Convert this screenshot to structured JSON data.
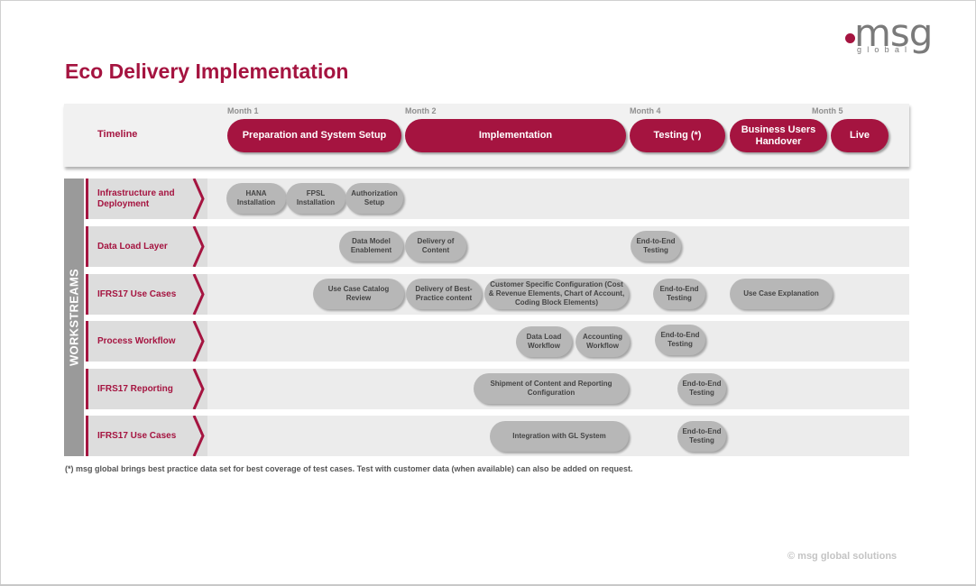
{
  "logo": {
    "word": "msg",
    "sub": "global"
  },
  "title": "Eco Delivery Implementation",
  "timeline": {
    "label": "Timeline",
    "months": [
      "Month 1",
      "Month 2",
      "Month 4",
      "Month 5"
    ],
    "phases": [
      "Preparation and System Setup",
      "Implementation",
      "Testing (*)",
      "Business Users Handover",
      "Live"
    ]
  },
  "workstreams": {
    "label": "WORKSTREAMS",
    "rows": [
      {
        "name": "Infrastructure and Deployment",
        "tasks": [
          "HANA Installation",
          "FPSL Installation",
          "Authorization Setup"
        ]
      },
      {
        "name": "Data Load Layer",
        "tasks": [
          "Data Model Enablement",
          "Delivery of Content",
          "End-to-End Testing"
        ]
      },
      {
        "name": "IFRS17 Use Cases",
        "tasks": [
          "Use Case Catalog Review",
          "Delivery of Best-Practice content",
          "Customer Specific Configuration (Cost & Revenue Elements, Chart of Account, Coding Block Elements)",
          "End-to-End Testing",
          "Use Case Explanation"
        ]
      },
      {
        "name": "Process Workflow",
        "tasks": [
          "Data Load Workflow",
          "Accounting Workflow",
          "End-to-End Testing"
        ]
      },
      {
        "name": "IFRS17 Reporting",
        "tasks": [
          "Shipment of Content and Reporting Configuration",
          "End-to-End Testing"
        ]
      },
      {
        "name": "IFRS17 Use Cases",
        "tasks": [
          "Integration with GL System",
          "End-to-End Testing"
        ]
      }
    ]
  },
  "footnote": "(*) msg global brings best practice data set for best coverage of test cases. Test with customer data (when available) can also be added on request.",
  "copyright": "© msg global solutions",
  "colors": {
    "accent": "#a51440",
    "task_fill": "#b7b7b7",
    "row_fill": "#ececec"
  }
}
